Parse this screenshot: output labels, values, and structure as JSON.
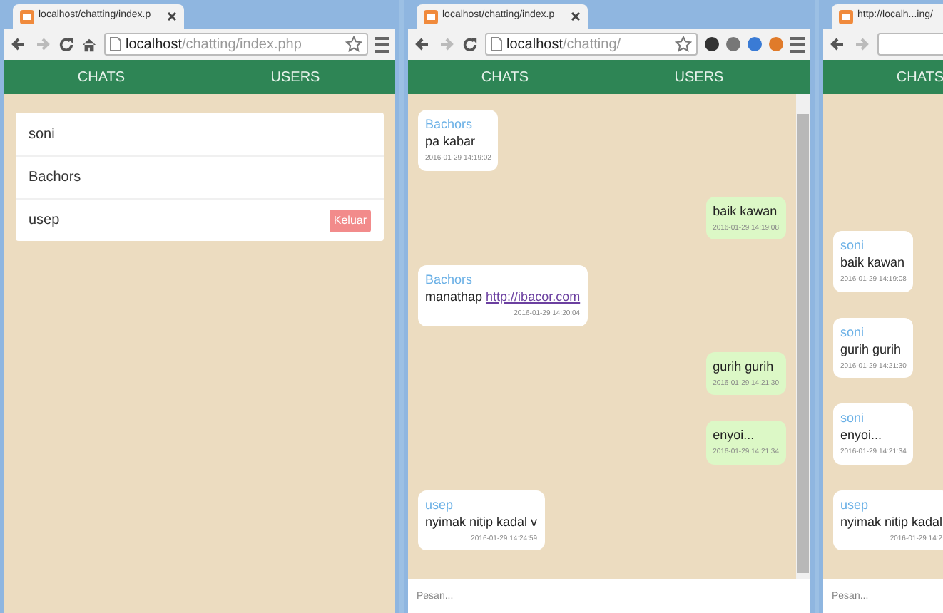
{
  "windows": [
    {
      "kind": "users",
      "tab_title": "localhost/chatting/index.p",
      "url_host": "localhost",
      "url_path": "/chatting/index.php",
      "nav": [
        "CHATS",
        "USERS"
      ],
      "users": [
        {
          "name": "soni"
        },
        {
          "name": "Bachors"
        },
        {
          "name": "usep",
          "badge": "Keluar"
        }
      ]
    },
    {
      "kind": "chat",
      "tab_title": "localhost/chatting/index.p",
      "url_host": "localhost",
      "url_path": "/chatting/",
      "nav": [
        "CHATS",
        "USERS"
      ],
      "messages": [
        {
          "kind": "incoming",
          "sender": "Bachors",
          "text": "pa kabar",
          "time": "2016-01-29 14:19:02"
        },
        {
          "kind": "outgoing",
          "text": "baik kawan",
          "time": "2016-01-29 14:19:08"
        },
        {
          "kind": "incoming",
          "sender": "Bachors",
          "text": "manathap",
          "link": "http://ibacor.com",
          "time": "2016-01-29 14:20:04"
        },
        {
          "kind": "outgoing",
          "text": "gurih gurih",
          "time": "2016-01-29 14:21:30"
        },
        {
          "kind": "outgoing",
          "text": "enyoi...",
          "time": "2016-01-29 14:21:34"
        },
        {
          "kind": "incoming",
          "sender": "usep",
          "text": "nyimak nitip kadal  v",
          "time": "2016-01-29 14:24:59"
        }
      ],
      "placeholder": "Pesan..."
    },
    {
      "kind": "chat",
      "tab_title": "http://localh...ing/",
      "nav": [
        "CHATS"
      ],
      "messages": [
        {
          "kind": "incoming",
          "sender": "soni",
          "text": "baik kawan",
          "time": "2016-01-29 14:19:08"
        },
        {
          "kind": "incoming",
          "sender": "soni",
          "text": "gurih gurih",
          "time": "2016-01-29 14:21:30"
        },
        {
          "kind": "incoming",
          "sender": "soni",
          "text": "enyoi...",
          "time": "2016-01-29 14:21:34"
        },
        {
          "kind": "incoming",
          "sender": "usep",
          "text": "nyimak nitip kadal",
          "time": "2016-01-29 14:2"
        }
      ],
      "placeholder": "Pesan..."
    }
  ]
}
